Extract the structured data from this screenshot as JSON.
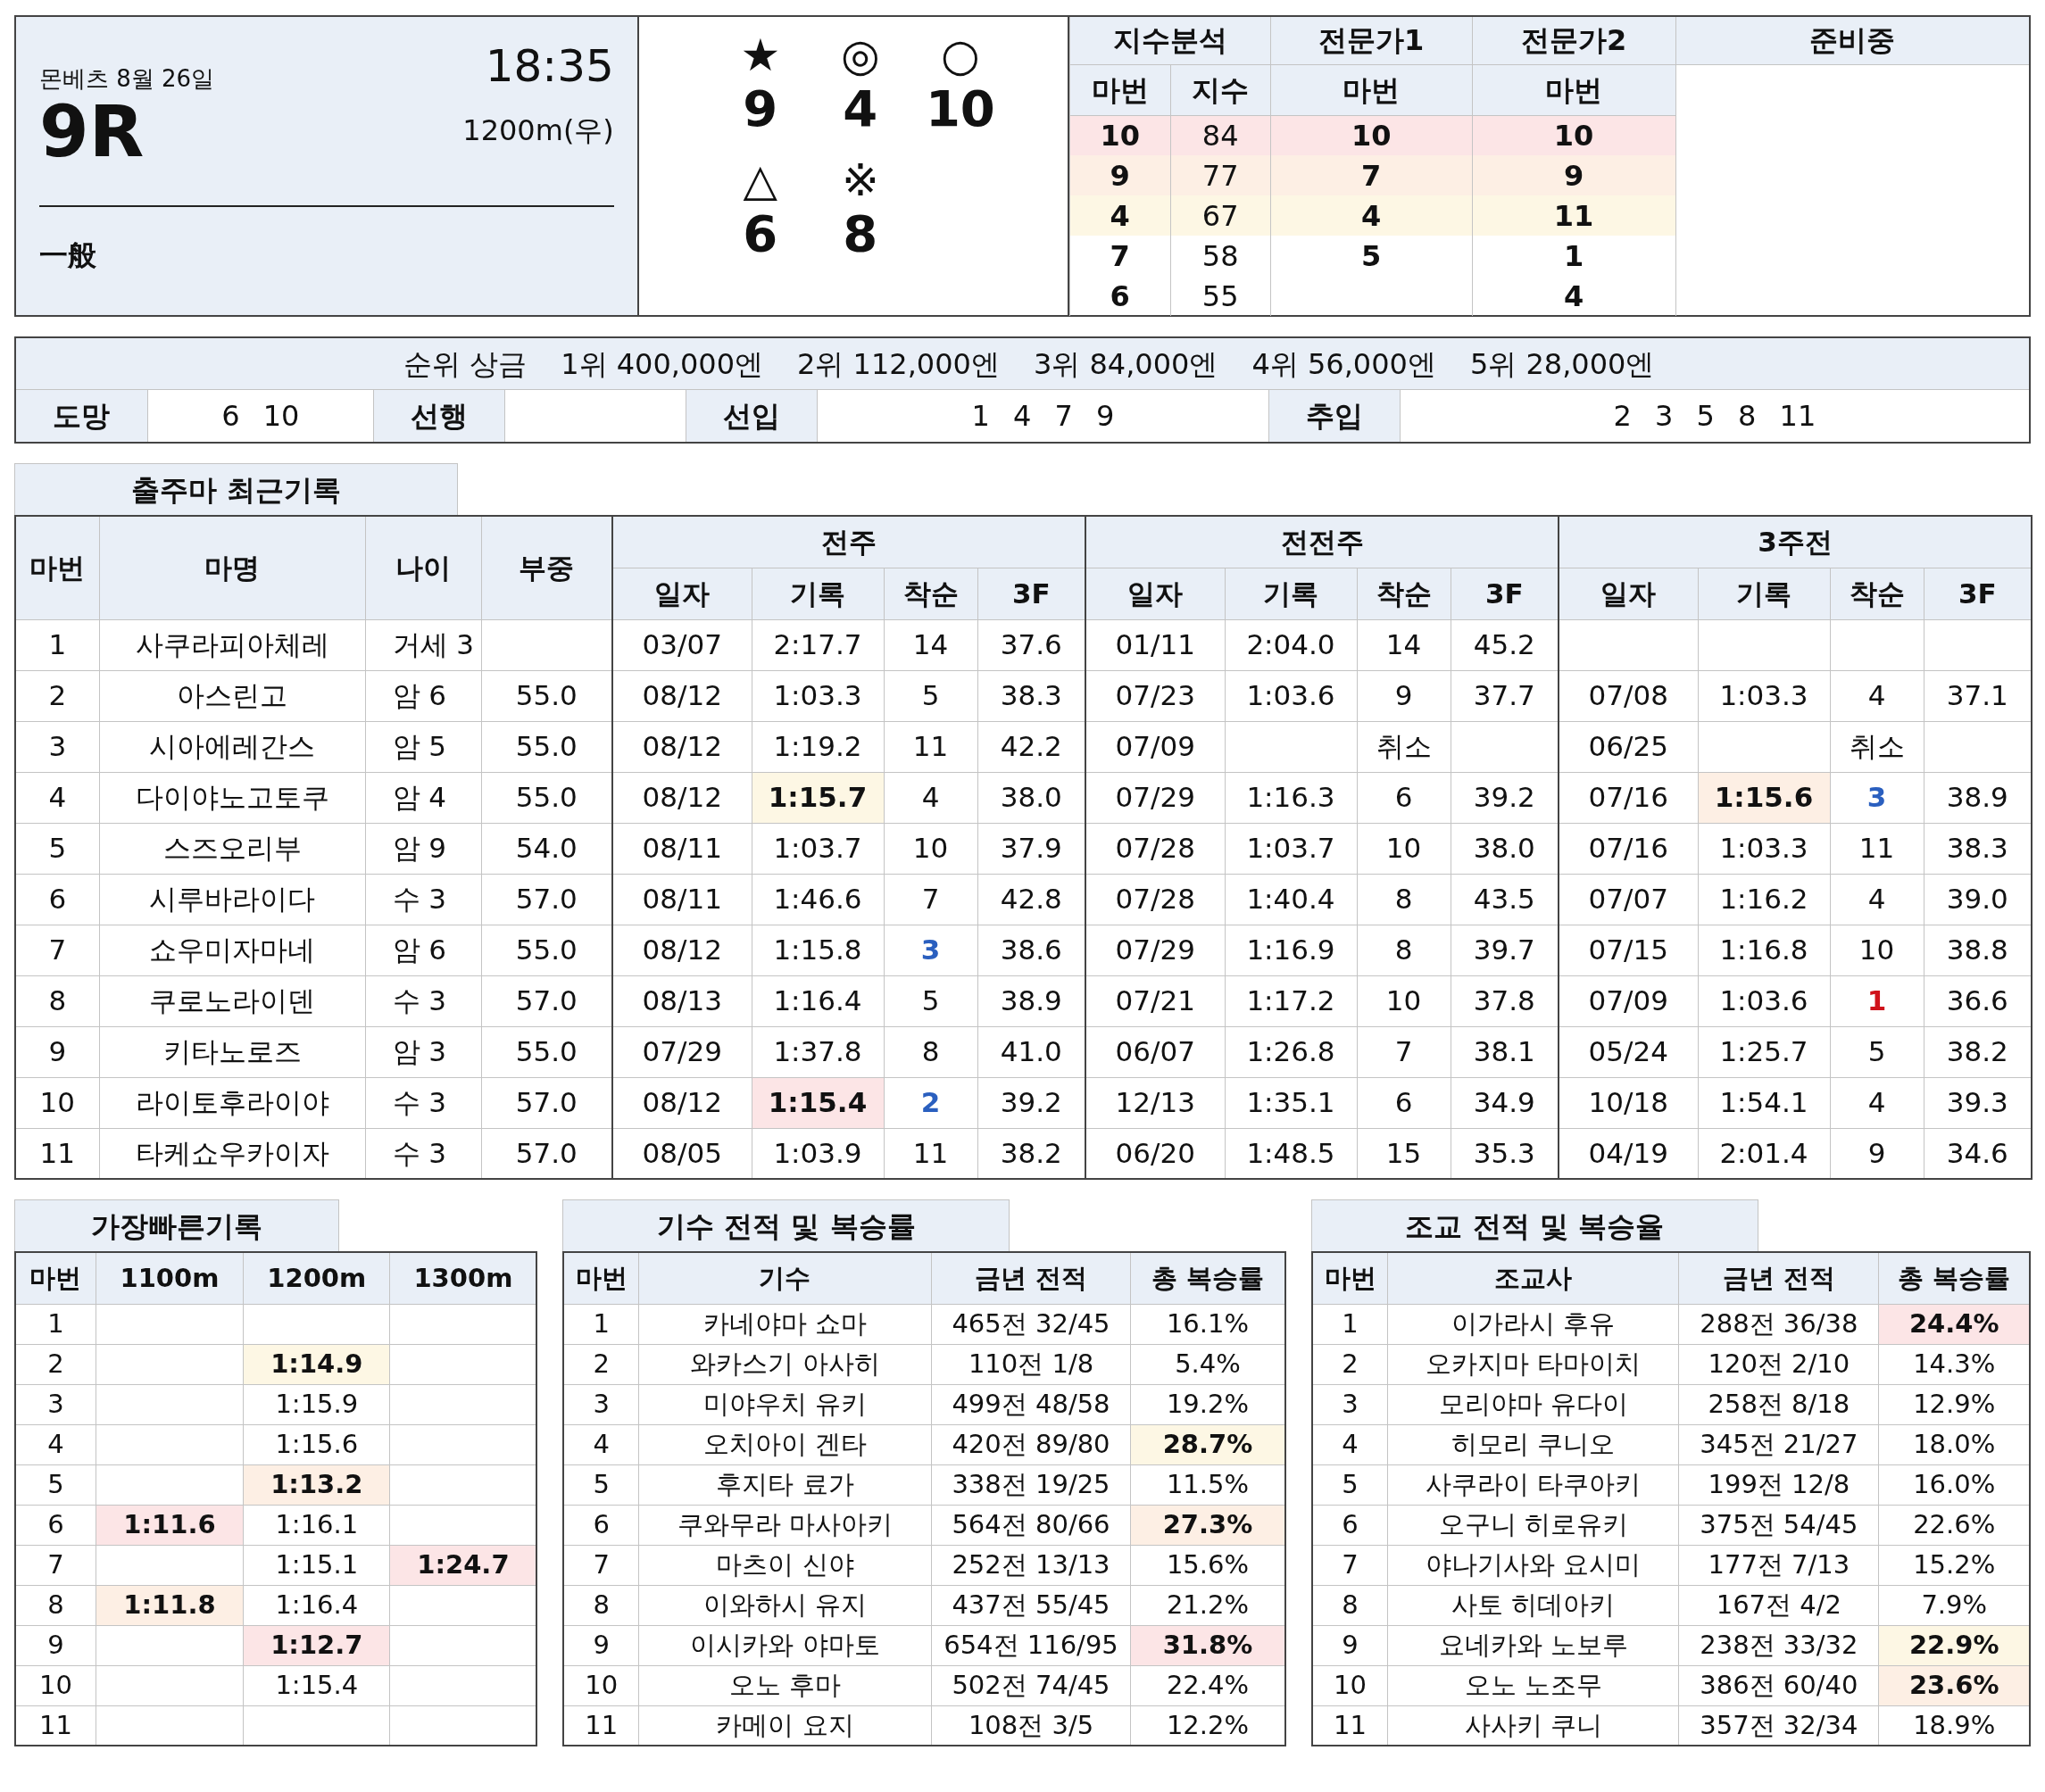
{
  "race": {
    "venue_date": "몬베츠 8월 26일",
    "time": "18:35",
    "number": "9R",
    "distance": "1200m(우)",
    "class": "一般"
  },
  "picks": [
    [
      {
        "symbol": "★",
        "number": "9"
      },
      {
        "symbol": "◎",
        "number": "4"
      },
      {
        "symbol": "○",
        "number": "10"
      }
    ],
    [
      {
        "symbol": "△",
        "number": "6"
      },
      {
        "symbol": "※",
        "number": "8"
      }
    ]
  ],
  "index_table": {
    "headers": [
      "지수분석",
      "전문가1",
      "전문가2",
      "준비중"
    ],
    "subheaders": [
      "마번",
      "지수",
      "마번",
      "마번"
    ],
    "rows": [
      {
        "color": "#fce5e6",
        "horse": "10",
        "score": "84",
        "expert1": "10",
        "expert2": "10"
      },
      {
        "color": "#fdefe4",
        "horse": "9",
        "score": "77",
        "expert1": "7",
        "expert2": "9"
      },
      {
        "color": "#fdf7e4",
        "horse": "4",
        "score": "67",
        "expert1": "4",
        "expert2": "11"
      },
      {
        "horse": "7",
        "score": "58",
        "expert1": "5",
        "expert2": "1"
      },
      {
        "horse": "6",
        "score": "55",
        "expert2": "4"
      }
    ]
  },
  "prize": {
    "label": "순위 상금",
    "items": [
      "1위 400,000엔",
      "2위 112,000엔",
      "3위 84,000엔",
      "4위 56,000엔",
      "5위 28,000엔"
    ]
  },
  "running_styles": [
    {
      "label": "도망",
      "numbers": "6 10"
    },
    {
      "label": "선행"
    },
    {
      "label": "선입",
      "numbers": "1 4 7 9"
    },
    {
      "label": "추입",
      "numbers": "2 3 5 8 11"
    }
  ],
  "recent": {
    "title": "출주마 최근기록",
    "columns": [
      "마번",
      "마명",
      "나이",
      "부중"
    ],
    "groups": [
      {
        "title": "전주",
        "columns": [
          "일자",
          "기록",
          "착순",
          "3F"
        ]
      },
      {
        "title": "전전주",
        "columns": [
          "일자",
          "기록",
          "착순",
          "3F"
        ]
      },
      {
        "title": "3주전",
        "columns": [
          "일자",
          "기록",
          "착순",
          "3F"
        ]
      }
    ],
    "rows": [
      {
        "number": "1",
        "name": "사쿠라피아체레",
        "age": "거세 3",
        "races": [
          {
            "date": "03/07",
            "time": "2:17.7",
            "place": "14",
            "f3": "37.6"
          },
          {
            "date": "01/11",
            "time": "2:04.0",
            "place": "14",
            "f3": "45.2"
          }
        ]
      },
      {
        "number": "2",
        "name": "아스린고",
        "age": "암 6",
        "weight": "55.0",
        "races": [
          {
            "date": "08/12",
            "time": "1:03.3",
            "place": "5",
            "f3": "38.3"
          },
          {
            "date": "07/23",
            "time": "1:03.6",
            "place": "9",
            "f3": "37.7"
          },
          {
            "date": "07/08",
            "time": "1:03.3",
            "place": "4",
            "f3": "37.1"
          }
        ]
      },
      {
        "number": "3",
        "name": "시아에레간스",
        "age": "암 5",
        "weight": "55.0",
        "races": [
          {
            "date": "08/12",
            "time": "1:19.2",
            "place": "11",
            "f3": "42.2"
          },
          {
            "date": "07/09",
            "place": "취소"
          },
          {
            "date": "06/25",
            "place": "취소"
          }
        ]
      },
      {
        "number": "4",
        "name": "다이야노고토쿠",
        "age": "암 4",
        "weight": "55.0",
        "races": [
          {
            "date": "08/12",
            "time": {
              "text": "1:15.7",
              "kind": "fill",
              "color": "#fdf7e4"
            },
            "place": "4",
            "f3": "38.0"
          },
          {
            "date": "07/29",
            "time": "1:16.3",
            "place": "6",
            "f3": "39.2"
          },
          {
            "date": "07/16",
            "time": {
              "text": "1:15.6",
              "kind": "fill",
              "color": "#fdefe4"
            },
            "place": {
              "text": "3",
              "kind": "ink",
              "color": "#2a5fbf"
            },
            "f3": "38.9"
          }
        ]
      },
      {
        "number": "5",
        "name": "스즈오리부",
        "age": "암 9",
        "weight": "54.0",
        "races": [
          {
            "date": "08/11",
            "time": "1:03.7",
            "place": "10",
            "f3": "37.9"
          },
          {
            "date": "07/28",
            "time": "1:03.7",
            "place": "10",
            "f3": "38.0"
          },
          {
            "date": "07/16",
            "time": "1:03.3",
            "place": "11",
            "f3": "38.3"
          }
        ]
      },
      {
        "number": "6",
        "name": "시루바라이다",
        "age": "수 3",
        "weight": "57.0",
        "races": [
          {
            "date": "08/11",
            "time": "1:46.6",
            "place": "7",
            "f3": "42.8"
          },
          {
            "date": "07/28",
            "time": "1:40.4",
            "place": "8",
            "f3": "43.5"
          },
          {
            "date": "07/07",
            "time": "1:16.2",
            "place": "4",
            "f3": "39.0"
          }
        ]
      },
      {
        "number": "7",
        "name": "쇼우미자마네",
        "age": "암 6",
        "weight": "55.0",
        "races": [
          {
            "date": "08/12",
            "time": "1:15.8",
            "place": {
              "text": "3",
              "kind": "ink",
              "color": "#2a5fbf"
            },
            "f3": "38.6"
          },
          {
            "date": "07/29",
            "time": "1:16.9",
            "place": "8",
            "f3": "39.7"
          },
          {
            "date": "07/15",
            "time": "1:16.8",
            "place": "10",
            "f3": "38.8"
          }
        ]
      },
      {
        "number": "8",
        "name": "쿠로노라이덴",
        "age": "수 3",
        "weight": "57.0",
        "races": [
          {
            "date": "08/13",
            "time": "1:16.4",
            "place": "5",
            "f3": "38.9"
          },
          {
            "date": "07/21",
            "time": "1:17.2",
            "place": "10",
            "f3": "37.8"
          },
          {
            "date": "07/09",
            "time": "1:03.6",
            "place": {
              "text": "1",
              "kind": "ink",
              "color": "#d0121b"
            },
            "f3": "36.6"
          }
        ]
      },
      {
        "number": "9",
        "name": "키타노로즈",
        "age": "암 3",
        "weight": "55.0",
        "races": [
          {
            "date": "07/29",
            "time": "1:37.8",
            "place": "8",
            "f3": "41.0"
          },
          {
            "date": "06/07",
            "time": "1:26.8",
            "place": "7",
            "f3": "38.1"
          },
          {
            "date": "05/24",
            "time": "1:25.7",
            "place": "5",
            "f3": "38.2"
          }
        ]
      },
      {
        "number": "10",
        "name": "라이토후라이야",
        "age": "수 3",
        "weight": "57.0",
        "races": [
          {
            "date": "08/12",
            "time": {
              "text": "1:15.4",
              "kind": "fill",
              "color": "#fce5e6"
            },
            "place": {
              "text": "2",
              "kind": "ink",
              "color": "#2a5fbf"
            },
            "f3": "39.2"
          },
          {
            "date": "12/13",
            "time": "1:35.1",
            "place": "6",
            "f3": "34.9"
          },
          {
            "date": "10/18",
            "time": "1:54.1",
            "place": "4",
            "f3": "39.3"
          }
        ]
      },
      {
        "number": "11",
        "name": "타케쇼우카이자",
        "age": "수 3",
        "weight": "57.0",
        "races": [
          {
            "date": "08/05",
            "time": "1:03.9",
            "place": "11",
            "f3": "38.2"
          },
          {
            "date": "06/20",
            "time": "1:48.5",
            "place": "15",
            "f3": "35.3"
          },
          {
            "date": "04/19",
            "time": "2:01.4",
            "place": "9",
            "f3": "34.6"
          }
        ]
      }
    ]
  },
  "fastest": {
    "title": "가장빠른기록",
    "columns": [
      "마번",
      "1100m",
      "1200m",
      "1300m"
    ],
    "rows": [
      {
        "number": "1"
      },
      {
        "number": "2",
        "m1200": {
          "text": "1:14.9",
          "kind": "fill",
          "color": "#fdf7e4"
        }
      },
      {
        "number": "3",
        "m1200": "1:15.9"
      },
      {
        "number": "4",
        "m1200": "1:15.6"
      },
      {
        "number": "5",
        "m1200": {
          "text": "1:13.2",
          "kind": "fill",
          "color": "#fdefe4"
        }
      },
      {
        "number": "6",
        "m1100": {
          "text": "1:11.6",
          "kind": "fill",
          "color": "#fce5e6"
        },
        "m1200": "1:16.1"
      },
      {
        "number": "7",
        "m1200": "1:15.1",
        "m1300": {
          "text": "1:24.7",
          "kind": "fill",
          "color": "#fce5e6"
        }
      },
      {
        "number": "8",
        "m1100": {
          "text": "1:11.8",
          "kind": "fill",
          "color": "#fdefe4"
        },
        "m1200": "1:16.4"
      },
      {
        "number": "9",
        "m1200": {
          "text": "1:12.7",
          "kind": "fill",
          "color": "#fce5e6"
        }
      },
      {
        "number": "10",
        "m1200": "1:15.4"
      },
      {
        "number": "11"
      }
    ]
  },
  "jockeys": {
    "title": "기수 전적 및 복승률",
    "columns": [
      "마번",
      "기수",
      "금년 전적",
      "총 복승률"
    ],
    "rows": [
      [
        "1",
        "카네야마 쇼마",
        "465전 32/45",
        "16.1%"
      ],
      [
        "2",
        "와카스기 아사히",
        "110전 1/8",
        "5.4%"
      ],
      [
        "3",
        "미야우치 유키",
        "499전 48/58",
        "19.2%"
      ],
      [
        "4",
        "오치아이 겐타",
        "420전 89/80",
        {
          "text": "28.7%",
          "kind": "fill",
          "color": "#fdf7e4"
        }
      ],
      [
        "5",
        "후지타 료가",
        "338전 19/25",
        "11.5%"
      ],
      [
        "6",
        "쿠와무라 마사아키",
        "564전 80/66",
        {
          "text": "27.3%",
          "kind": "fill",
          "color": "#fdefe4"
        }
      ],
      [
        "7",
        "마츠이 신야",
        "252전 13/13",
        "15.6%"
      ],
      [
        "8",
        "이와하시 유지",
        "437전 55/45",
        "21.2%"
      ],
      [
        "9",
        "이시카와 야마토",
        "654전 116/95",
        {
          "text": "31.8%",
          "kind": "fill",
          "color": "#fce5e6"
        }
      ],
      [
        "10",
        "오노 후마",
        "502전 74/45",
        "22.4%"
      ],
      [
        "11",
        "카메이 요지",
        "108전 3/5",
        "12.2%"
      ]
    ]
  },
  "trainers": {
    "title": "조교 전적 및 복승율",
    "columns": [
      "마번",
      "조교사",
      "금년 전적",
      "총 복승률"
    ],
    "rows": [
      [
        "1",
        "이가라시 후유",
        "288전 36/38",
        {
          "text": "24.4%",
          "kind": "fill",
          "color": "#fce5e6"
        }
      ],
      [
        "2",
        "오카지마 타마이치",
        "120전 2/10",
        "14.3%"
      ],
      [
        "3",
        "모리야마 유다이",
        "258전 8/18",
        "12.9%"
      ],
      [
        "4",
        "히모리 쿠니오",
        "345전 21/27",
        "18.0%"
      ],
      [
        "5",
        "사쿠라이 타쿠아키",
        "199전 12/8",
        "16.0%"
      ],
      [
        "6",
        "오구니 히로유키",
        "375전 54/45",
        "22.6%"
      ],
      [
        "7",
        "야나기사와 요시미",
        "177전 7/13",
        "15.2%"
      ],
      [
        "8",
        "사토 히데아키",
        "167전 4/2",
        "7.9%"
      ],
      [
        "9",
        "요네카와 노보루",
        "238전 33/32",
        {
          "text": "22.9%",
          "kind": "fill",
          "color": "#fdf7e4"
        }
      ],
      [
        "10",
        "오노 노조무",
        "386전 60/40",
        {
          "text": "23.6%",
          "kind": "fill",
          "color": "#fdefe4"
        }
      ],
      [
        "11",
        "사사키 쿠니",
        "357전 32/34",
        "18.9%"
      ]
    ]
  }
}
